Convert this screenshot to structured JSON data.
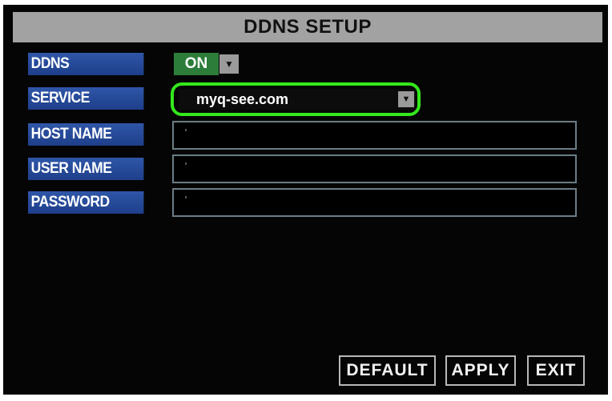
{
  "window": {
    "title": "DDNS SETUP"
  },
  "fields": {
    "ddns": {
      "label": "DDNS",
      "value": "ON"
    },
    "service": {
      "label": "SERVICE",
      "value": "myq-see.com"
    },
    "host_name": {
      "label": "HOST NAME",
      "value": ""
    },
    "user_name": {
      "label": "USER NAME",
      "value": ""
    },
    "password": {
      "label": "PASSWORD",
      "value": ""
    }
  },
  "buttons": {
    "default": "DEFAULT",
    "apply": "APPLY",
    "exit": "EXIT"
  },
  "icons": {
    "dropdown": "chevron-down-icon"
  },
  "colors": {
    "label_bg": "#1e3f8a",
    "toggle_on": "#2c7d3a",
    "highlight": "#34e81c",
    "title_bar": "#a2a2a2"
  }
}
